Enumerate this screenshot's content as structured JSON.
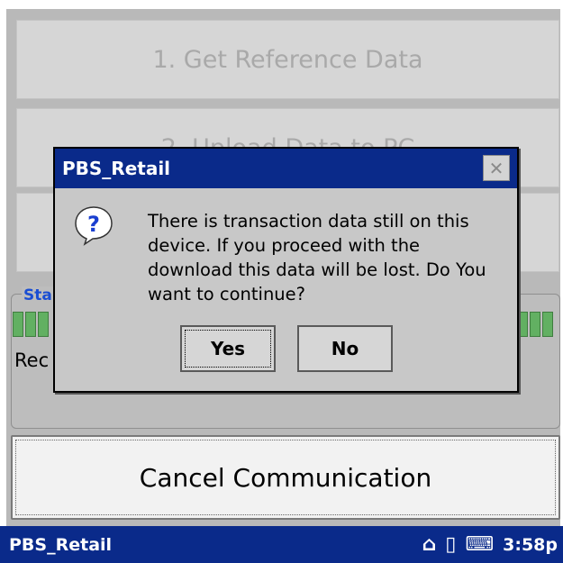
{
  "background_buttons": {
    "get_reference_data": "1. Get Reference Data",
    "upload_data_partial": "2. Upload Data to PC"
  },
  "status": {
    "legend_partial": "Sta",
    "received_partial": "Rec"
  },
  "cancel_button": {
    "label": "Cancel Communication"
  },
  "dialog": {
    "title": "PBS_Retail",
    "close_symbol": "✕",
    "message": "There is transaction data still on this device. If you proceed with the download this data will be lost. Do You want to continue?",
    "yes_label": "Yes",
    "no_label": "No"
  },
  "taskbar": {
    "app_name": "PBS_Retail",
    "home_icon": "⌂",
    "battery_icon": "▯",
    "keyboard_icon": "⌨",
    "time": "3:58p"
  },
  "colors": {
    "titlebar": "#0a2a8a",
    "progress": "#62b062",
    "legend": "#1a4ed3"
  }
}
